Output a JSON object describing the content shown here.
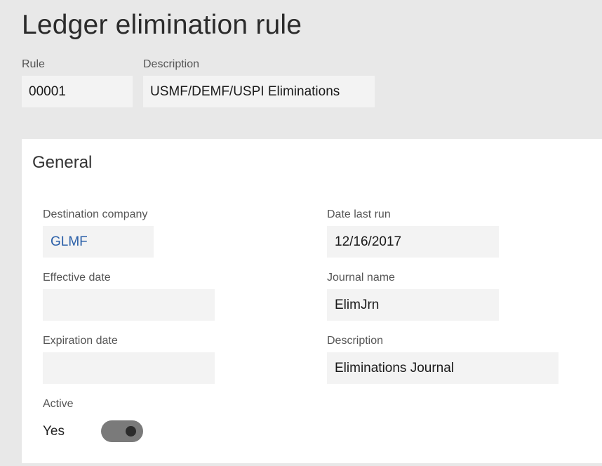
{
  "page": {
    "title": "Ledger elimination rule"
  },
  "header": {
    "rule_label": "Rule",
    "rule_value": "00001",
    "description_label": "Description",
    "description_value": "USMF/DEMF/USPI Eliminations"
  },
  "general": {
    "title": "General",
    "destination_company_label": "Destination company",
    "destination_company_value": "GLMF",
    "effective_date_label": "Effective date",
    "effective_date_value": "",
    "expiration_date_label": "Expiration date",
    "expiration_date_value": "",
    "active_label": "Active",
    "active_value": "Yes",
    "date_last_run_label": "Date last run",
    "date_last_run_value": "12/16/2017",
    "journal_name_label": "Journal name",
    "journal_name_value": "ElimJrn",
    "description_label": "Description",
    "description_value": "Eliminations Journal"
  },
  "colors": {
    "background": "#e8e8e8",
    "card": "#ffffff",
    "field": "#f3f3f3",
    "link": "#2a5fa8",
    "toggle_track": "#7a7a7a"
  }
}
